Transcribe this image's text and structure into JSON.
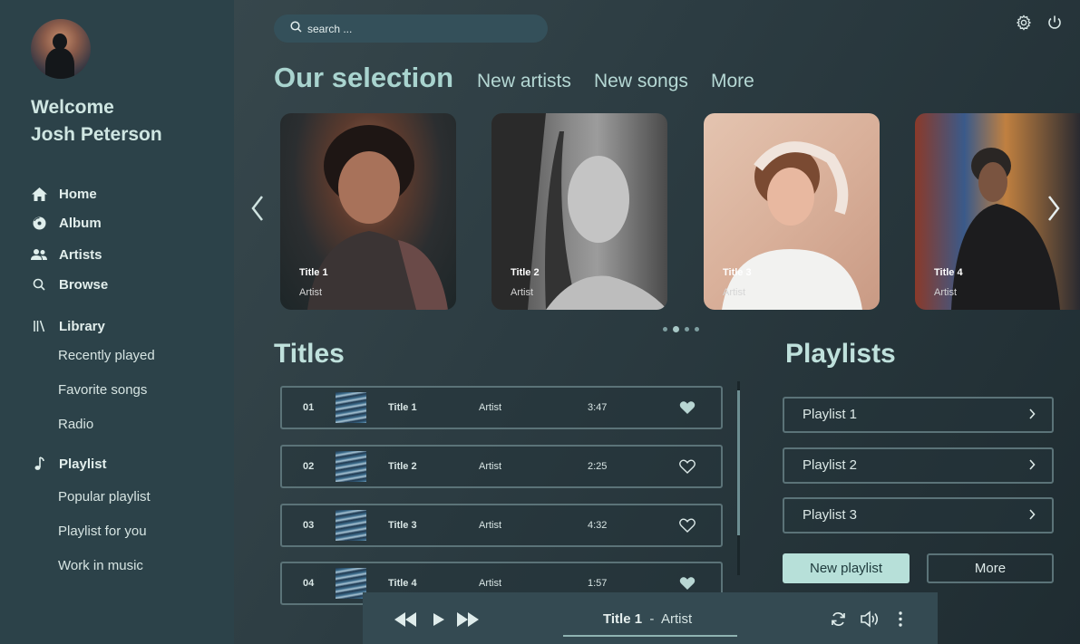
{
  "user": {
    "welcome_line1": "Welcome",
    "welcome_line2": "Josh Peterson"
  },
  "nav": {
    "home": "Home",
    "album": "Album",
    "artists": "Artists",
    "browse": "Browse",
    "library": "Library",
    "library_items": [
      "Recently played",
      "Favorite songs",
      "Radio"
    ],
    "playlist": "Playlist",
    "playlist_items": [
      "Popular playlist",
      "Playlist for you",
      "Work in music"
    ]
  },
  "search": {
    "placeholder": "search ..."
  },
  "header": {
    "title": "Our selection",
    "tabs": [
      "New artists",
      "New songs",
      "More"
    ]
  },
  "carousel": {
    "cards": [
      {
        "title": "Title 1",
        "artist": "Artist"
      },
      {
        "title": "Title 2",
        "artist": "Artist"
      },
      {
        "title": "Title 3",
        "artist": "Artist"
      },
      {
        "title": "Title 4",
        "artist": "Artist"
      }
    ],
    "page_count": 4,
    "active_page": 2
  },
  "titles": {
    "heading": "Titles",
    "rows": [
      {
        "num": "01",
        "title": "Title 1",
        "artist": "Artist",
        "duration": "3:47",
        "favorite": true
      },
      {
        "num": "02",
        "title": "Title 2",
        "artist": "Artist",
        "duration": "2:25",
        "favorite": false
      },
      {
        "num": "03",
        "title": "Title 3",
        "artist": "Artist",
        "duration": "4:32",
        "favorite": false
      },
      {
        "num": "04",
        "title": "Title 4",
        "artist": "Artist",
        "duration": "1:57",
        "favorite": true
      }
    ]
  },
  "playlists": {
    "heading": "Playlists",
    "items": [
      "Playlist 1",
      "Playlist 2",
      "Playlist 3"
    ],
    "new_label": "New playlist",
    "more_label": "More"
  },
  "player": {
    "title": "Title 1",
    "separator": "-",
    "artist": "Artist"
  },
  "colors": {
    "sidebar_bg": "#2c4249",
    "accent": "#b7e0d9",
    "heading": "#a9d4cf"
  }
}
